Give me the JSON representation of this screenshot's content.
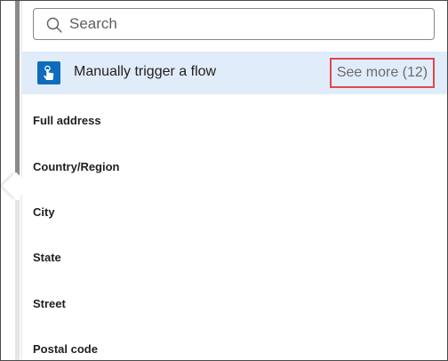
{
  "search": {
    "placeholder": "Search"
  },
  "trigger_section": {
    "title": "Manually trigger a flow",
    "see_more_label": "See more (12)",
    "icon": "hand-tap-icon"
  },
  "fields": [
    {
      "label": "Full address"
    },
    {
      "label": "Country/Region"
    },
    {
      "label": "City"
    },
    {
      "label": "State"
    },
    {
      "label": "Street"
    },
    {
      "label": "Postal code"
    }
  ],
  "colors": {
    "trigger_background": "#e1ecfa",
    "trigger_icon": "#0f6cbd",
    "highlight_border": "#e0474c"
  }
}
